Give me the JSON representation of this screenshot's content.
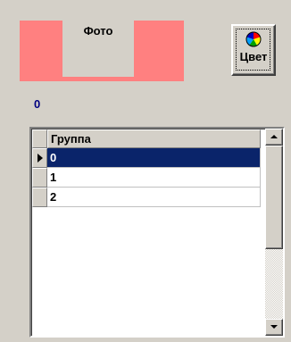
{
  "photo": {
    "label": "Фото",
    "background_color": "#ff8080"
  },
  "color_button": {
    "label": "Цвет",
    "icon": "color-wheel-icon"
  },
  "value_label": "0",
  "grid": {
    "column_header": "Группа",
    "rows": [
      {
        "value": "0",
        "selected": true
      },
      {
        "value": "1",
        "selected": false
      },
      {
        "value": "2",
        "selected": false
      }
    ],
    "selection_color": "#0a246a"
  },
  "scrollbar": {
    "up_icon": "arrow-up-icon",
    "down_icon": "arrow-down-icon"
  }
}
